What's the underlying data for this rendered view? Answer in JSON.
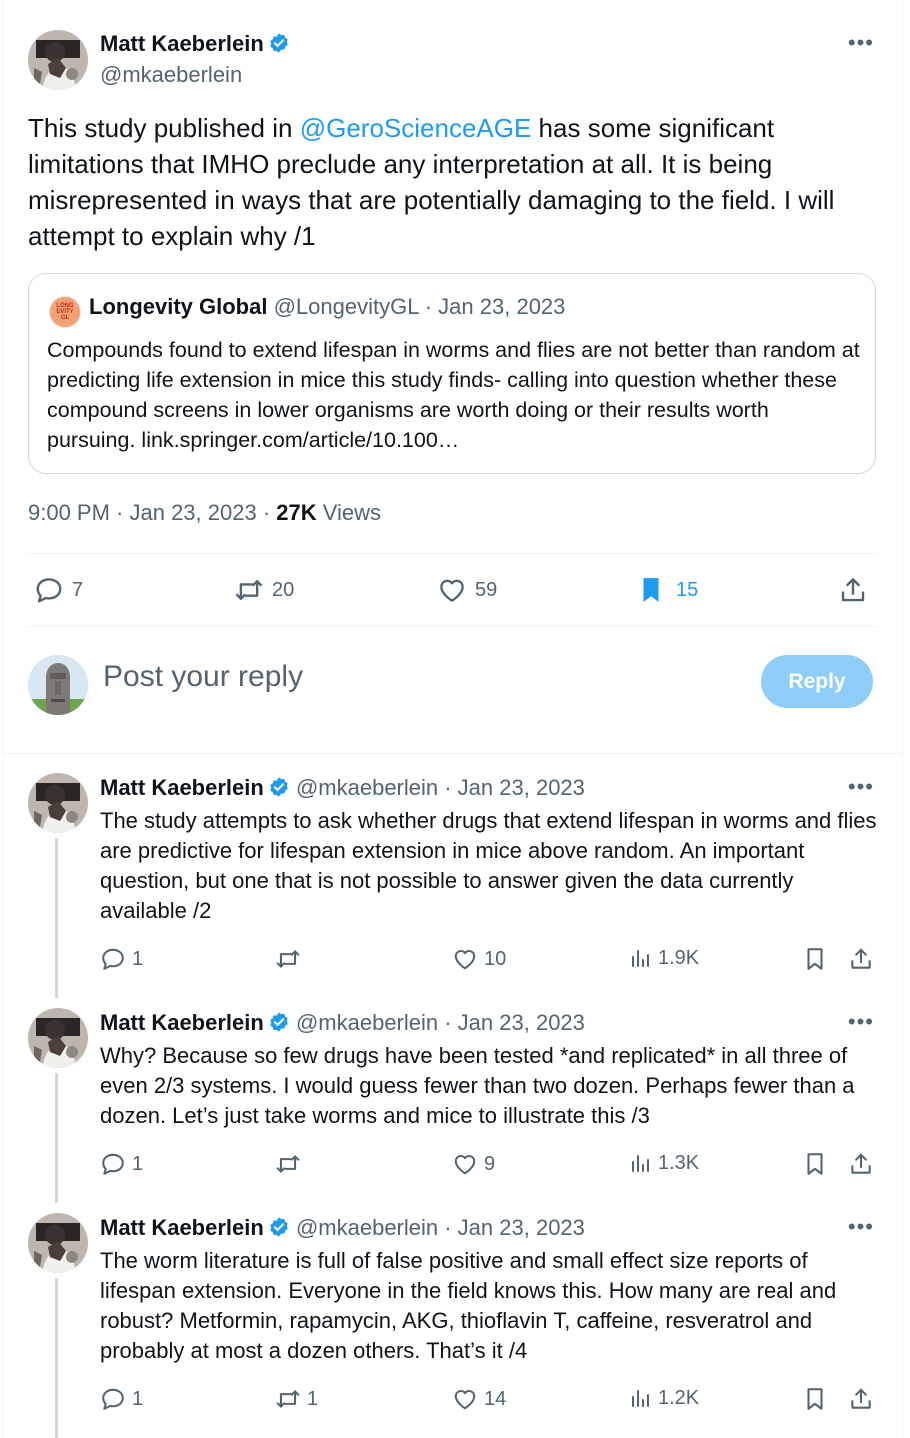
{
  "colors": {
    "accent": "#1d9bf0",
    "text": "#0f1419",
    "secondary": "#536471",
    "reply_button": "#8ecdf8"
  },
  "main_tweet": {
    "author_name": "Matt Kaeberlein",
    "handle": "@mkaeberlein",
    "text_before": "This study published in ",
    "mention": "@GeroScienceAGE",
    "text_after": " has some significant limitations that IMHO preclude any interpretation at all. It is being misrepresented in ways that are potentially damaging to the field. I will attempt to explain why /1",
    "timestamp": "9:00 PM · Jan 23, 2023 · ",
    "views_count": "27K",
    "views_label": " Views",
    "stats": {
      "replies": "7",
      "retweets": "20",
      "likes": "59",
      "bookmarks": "15"
    }
  },
  "quoted_tweet": {
    "avatar_text": "LONG EVITY GL",
    "author_name": "Longevity Global",
    "handle_date": "@LongevityGL · Jan 23, 2023",
    "text": "Compounds found to extend lifespan in worms and flies are not better than random at predicting life extension in mice this study finds- calling into question whether these compound screens in lower organisms are worth doing or their results worth pursuing. link.springer.com/article/10.100…"
  },
  "composer": {
    "placeholder": "Post your reply",
    "button_label": "Reply"
  },
  "replies": [
    {
      "author_name": "Matt Kaeberlein",
      "handle_date": "@mkaeberlein · Jan 23, 2023",
      "text": "The study attempts to ask whether drugs that extend lifespan in worms and flies are predictive for lifespan extension in mice above random. An important question, but one that is not possible to answer given the data currently available /2",
      "replies": "1",
      "retweets": "",
      "likes": "10",
      "views": "1.9K"
    },
    {
      "author_name": "Matt Kaeberlein",
      "handle_date": "@mkaeberlein · Jan 23, 2023",
      "text": "Why? Because so few drugs have been tested *and replicated* in all three of even 2/3 systems. I would guess fewer than two dozen. Perhaps fewer than a dozen. Let’s just take worms and mice to illustrate this /3",
      "replies": "1",
      "retweets": "",
      "likes": "9",
      "views": "1.3K"
    },
    {
      "author_name": "Matt Kaeberlein",
      "handle_date": "@mkaeberlein · Jan 23, 2023",
      "text": "The worm literature is full of false positive and small effect size reports of lifespan extension. Everyone in the field knows this. How many are real and robust? Metformin, rapamycin, AKG, thioflavin T, caffeine, resveratrol and probably at most a dozen others. That’s it /4",
      "replies": "1",
      "retweets": "1",
      "likes": "14",
      "views": "1.2K"
    }
  ]
}
